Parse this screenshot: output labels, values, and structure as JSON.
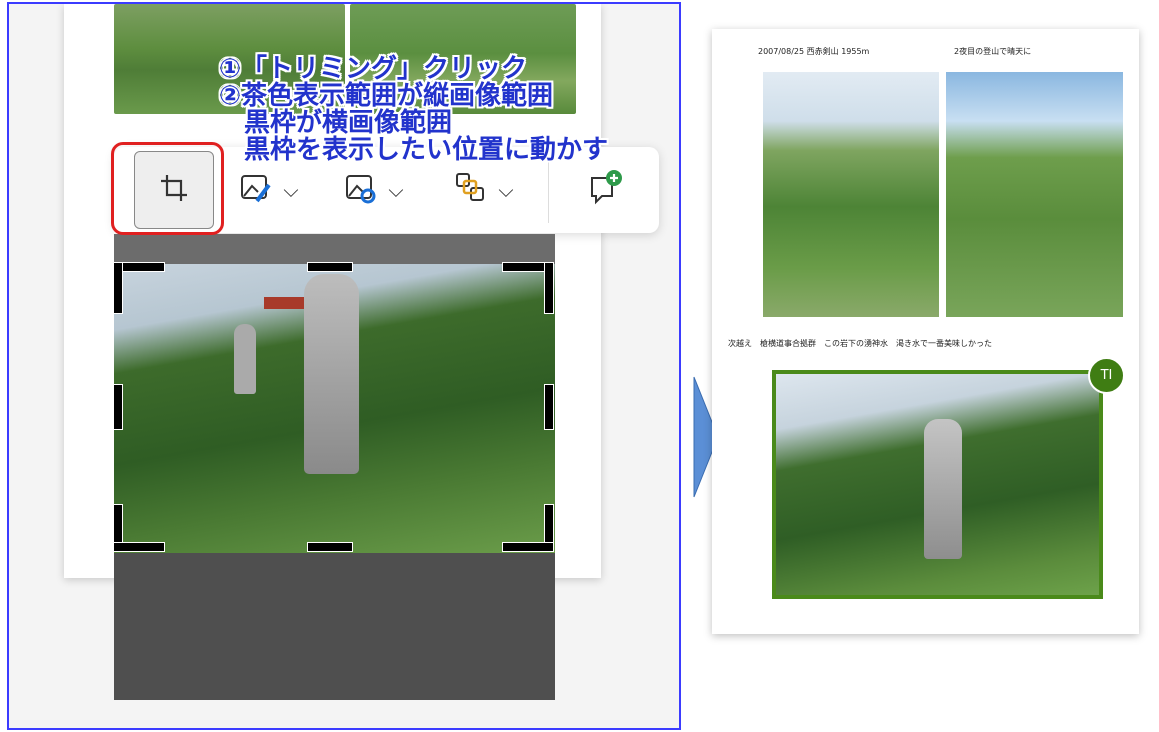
{
  "annotation": {
    "line1": "①「トリミング」クリック",
    "line2": "②茶色表示範囲が縦画像範囲",
    "line3": "黒枠が横画像範囲",
    "line4": "黒枠を表示したい位置に動かす"
  },
  "toolbar": {
    "crop_icon": "crop-icon",
    "image_edit_icon": "image-brush-icon",
    "image_replace_icon": "image-replace-icon",
    "arrange_icon": "arrange-shapes-icon",
    "comment_icon": "add-comment-icon",
    "chevron": "⌵"
  },
  "right_doc": {
    "caption_top_left": "2007/08/25 西赤剣山 1955m",
    "caption_top_right": "2夜目の登山で晴天に",
    "caption_middle": "次越え　槍横道事合拠群　この岩下の湧神水　渇き水で一番美味しかった",
    "avatar_initials": "TI"
  },
  "colors": {
    "frame_border": "#3b3bff",
    "annotation_text": "#2233cc",
    "crop_highlight": "#e02020",
    "selected_image_border": "#4a8a1a",
    "avatar_bg": "#3f7d13",
    "arrow_fill": "#5b8fd6"
  }
}
